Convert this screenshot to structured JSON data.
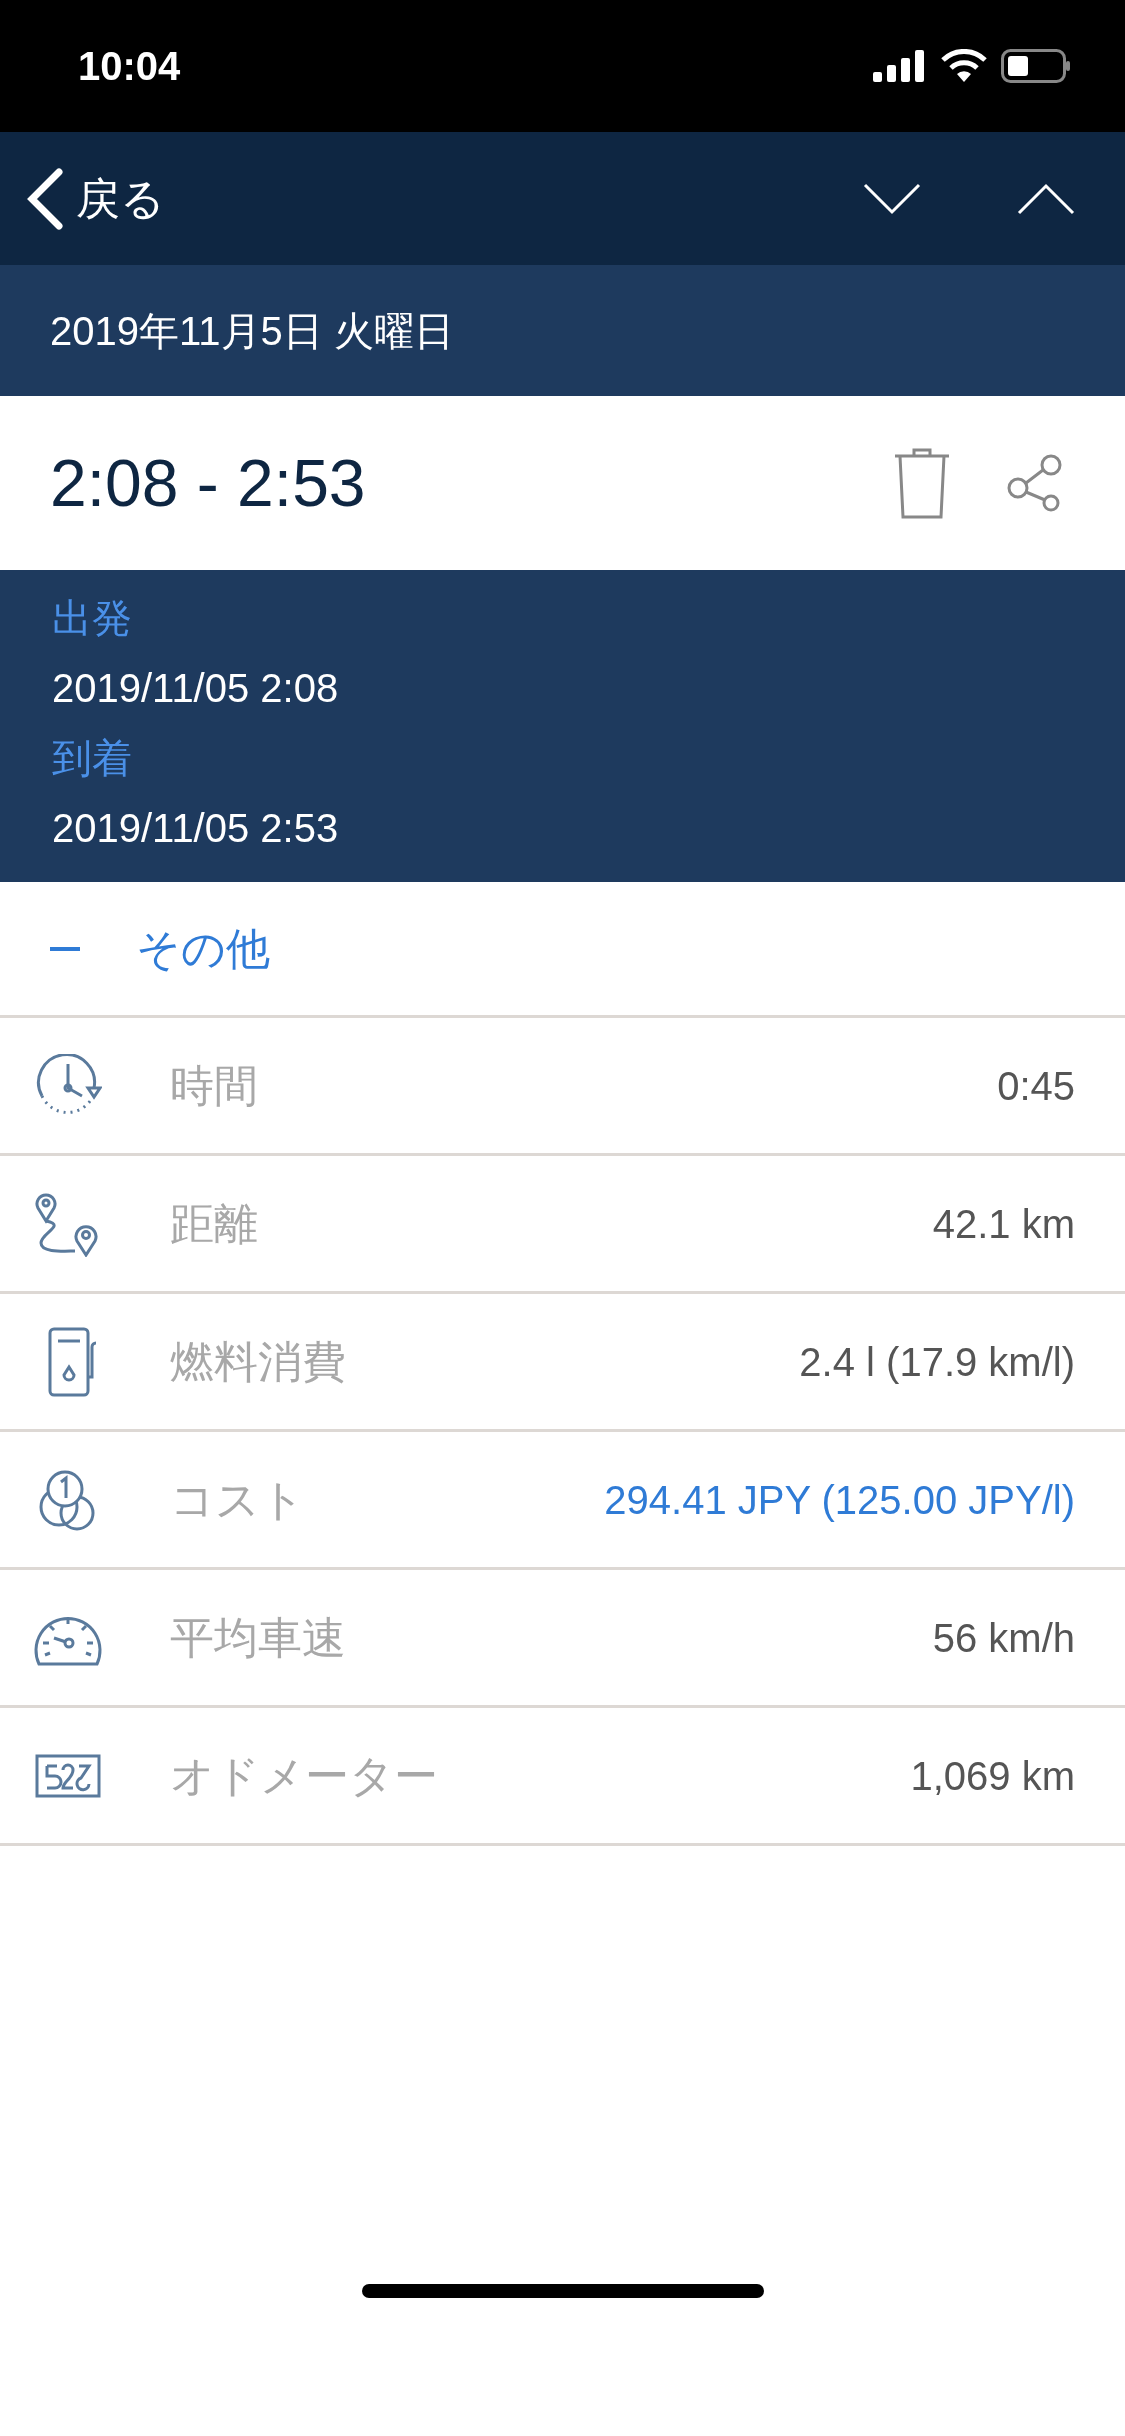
{
  "status_bar": {
    "time": "10:04"
  },
  "nav": {
    "back_label": "戻る"
  },
  "date_header": "2019年11月5日 火曜日",
  "trip": {
    "time_range": "2:08 - 2:53"
  },
  "details": [
    {
      "label": "出発",
      "value": "2019/11/05 2:08"
    },
    {
      "label": "到着",
      "value": "2019/11/05 2:53"
    }
  ],
  "section": {
    "title": "その他",
    "expanded": true
  },
  "rows": [
    {
      "kind": "clock",
      "label": "時間",
      "value": "0:45",
      "highlighted": false
    },
    {
      "kind": "route",
      "label": "距離",
      "value": "42.1 km",
      "highlighted": false
    },
    {
      "kind": "fuel",
      "label": "燃料消費",
      "value": "2.4 l (17.9 km/l)",
      "highlighted": false
    },
    {
      "kind": "coins",
      "label": "コスト",
      "value": "294.41 JPY (125.00 JPY/l)",
      "highlighted": true
    },
    {
      "kind": "speedometer",
      "label": "平均車速",
      "value": "56 km/h",
      "highlighted": false
    },
    {
      "kind": "odometer",
      "label": "オドメーター",
      "value": "1,069 km",
      "highlighted": false
    }
  ]
}
